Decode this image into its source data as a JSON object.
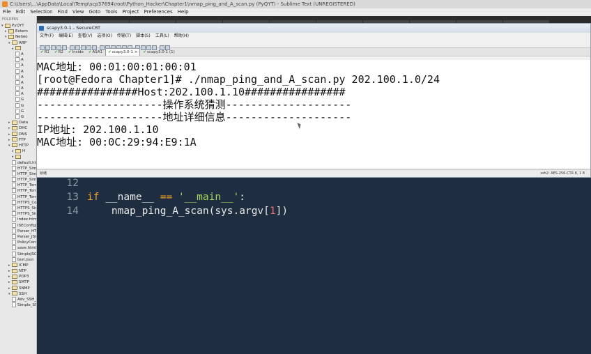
{
  "sublime": {
    "title": "C:\\Users\\...\\AppData\\Local\\Temp\\scp37694\\root\\Python_Hacker\\Chapter1\\nmap_ping_and_A_scan.py (PyQYT) - Sublime Text (UNREGISTERED)",
    "menu": [
      "File",
      "Edit",
      "Selection",
      "Find",
      "View",
      "Goto",
      "Tools",
      "Project",
      "Preferences",
      "Help"
    ],
    "tabs": [
      "",
      "",
      "",
      "",
      "",
      "",
      "",
      "",
      "",
      "",
      ""
    ],
    "sidebar": {
      "header": "FOLDERS",
      "items": [
        {
          "label": "PyQYT",
          "type": "folder",
          "open": true
        },
        {
          "label": "Extern",
          "type": "folder",
          "open": false
        },
        {
          "label": "Netwo",
          "type": "folder",
          "open": true
        },
        {
          "label": "ARP",
          "type": "folder",
          "open": true
        },
        {
          "label": "",
          "type": "folder",
          "open": false
        },
        {
          "label": "A",
          "type": "file"
        },
        {
          "label": "A",
          "type": "file"
        },
        {
          "label": "A",
          "type": "file"
        },
        {
          "label": "A",
          "type": "file"
        },
        {
          "label": "A",
          "type": "file"
        },
        {
          "label": "A",
          "type": "file"
        },
        {
          "label": "A",
          "type": "file"
        },
        {
          "label": "A",
          "type": "file"
        },
        {
          "label": "G",
          "type": "file"
        },
        {
          "label": "G",
          "type": "file"
        },
        {
          "label": "G",
          "type": "file"
        },
        {
          "label": "G",
          "type": "file"
        },
        {
          "label": "Data",
          "type": "folder",
          "open": false
        },
        {
          "label": "DHC",
          "type": "folder",
          "open": false
        },
        {
          "label": "DNS",
          "type": "folder",
          "open": false
        },
        {
          "label": "FTP",
          "type": "folder",
          "open": false
        },
        {
          "label": "HTTP",
          "type": "folder",
          "open": true
        },
        {
          "label": "H",
          "type": "folder",
          "open": false
        },
        {
          "label": "",
          "type": "folder",
          "open": false
        },
        {
          "label": "default.html",
          "type": "file"
        },
        {
          "label": "HTTP_Simple",
          "type": "file"
        },
        {
          "label": "HTTP_Simple",
          "type": "file"
        },
        {
          "label": "HTTP_Simple",
          "type": "file"
        },
        {
          "label": "HTTP_Tornado",
          "type": "file"
        },
        {
          "label": "HTTP_Tornado",
          "type": "file"
        },
        {
          "label": "HTTP_Tornado",
          "type": "file"
        },
        {
          "label": "HTTPS_Cookie",
          "type": "file"
        },
        {
          "label": "HTTPS_Simple",
          "type": "file"
        },
        {
          "label": "HTTPS_Simple",
          "type": "file"
        },
        {
          "label": "index.html",
          "type": "file"
        },
        {
          "label": "ISEConfigPars",
          "type": "file"
        },
        {
          "label": "Parser_HTML.p",
          "type": "file"
        },
        {
          "label": "Parser_JSON.p",
          "type": "file"
        },
        {
          "label": "PolicyConfig.j",
          "type": "file"
        },
        {
          "label": "save.html",
          "type": "file"
        },
        {
          "label": "SimpleJSON.p",
          "type": "file"
        },
        {
          "label": "test.json",
          "type": "file"
        },
        {
          "label": "ICMP",
          "type": "folder",
          "open": false
        },
        {
          "label": "NTP",
          "type": "folder",
          "open": false
        },
        {
          "label": "POP3",
          "type": "folder",
          "open": false
        },
        {
          "label": "SMTP",
          "type": "folder",
          "open": false
        },
        {
          "label": "SNMP",
          "type": "folder",
          "open": false
        },
        {
          "label": "SSH",
          "type": "folder",
          "open": true
        },
        {
          "label": "Adv_SSH_Clie",
          "type": "file"
        },
        {
          "label": "Simple_SSH_",
          "type": "file"
        }
      ]
    },
    "code": [
      {
        "num": "12",
        "parts": []
      },
      {
        "num": "13",
        "parts": [
          {
            "t": "if",
            "c": "kw"
          },
          {
            "t": " __name__ ",
            "c": "var"
          },
          {
            "t": "==",
            "c": "kw"
          },
          {
            "t": " ",
            "c": "var"
          },
          {
            "t": "'__main__'",
            "c": "str"
          },
          {
            "t": ":",
            "c": "op"
          }
        ]
      },
      {
        "num": "14",
        "parts": [
          {
            "t": "    nmap_ping_A_scan(sys.argv[",
            "c": "var"
          },
          {
            "t": "1",
            "c": "num"
          },
          {
            "t": "])",
            "c": "var"
          }
        ]
      }
    ]
  },
  "securecrt": {
    "title": "scapy3.0-1 - SecureCRT",
    "menu": [
      "文件(F)",
      "编辑(E)",
      "查看(V)",
      "选项(O)",
      "传输(T)",
      "脚本(S)",
      "工具(L)",
      "帮助(H)"
    ],
    "toolbar_count": 22,
    "sessions": [
      {
        "label": "R1",
        "active": false
      },
      {
        "label": "R2",
        "active": false
      },
      {
        "label": "Inside",
        "active": false
      },
      {
        "label": "ASA1",
        "active": false
      },
      {
        "label": "scapy3.0-1",
        "active": true
      },
      {
        "label": "scapy3.0-1 (1)",
        "active": false
      }
    ],
    "terminal_lines": [
      "MAC地址: 00:01:00:01:00:01",
      "[root@Fedora Chapter1]# ./nmap_ping_and_A_scan.py 202.100.1.0/24",
      "################Host:202.100.1.10################",
      "--------------------操作系统猜测--------------------",
      "--------------------地址详细信息--------------------",
      "IP地址: 202.100.1.10",
      "MAC地址: 00:0C:29:94:E9:1A"
    ],
    "status_left": "就绪",
    "status_right": "ssh2: AES-256-CTR      8, 1      8"
  }
}
